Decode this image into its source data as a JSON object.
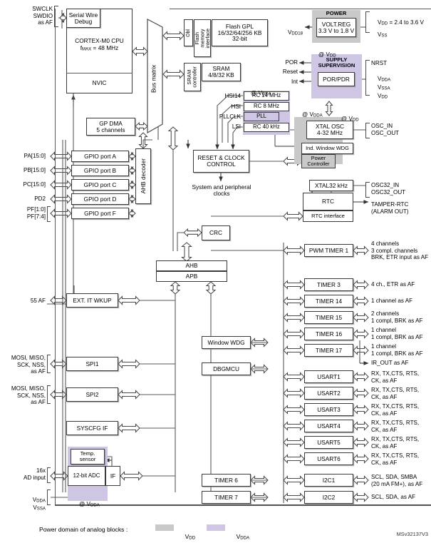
{
  "figure": {
    "id": "MSv32137V3",
    "legend_text": "Power domain of analog blocks :",
    "legend_vdd": "V",
    "legend_vdd_sub": "DD",
    "legend_vdda": "V",
    "legend_vdda_sub": "DDA",
    "color_vdd": "#c9c9c9",
    "color_vdda": "#cfc6e4"
  },
  "core": {
    "swd_pins": "SWCLK\nSWDIO\nas AF",
    "serial_wire_debug": "Serial Wire\nDebug",
    "cpu_line1": "CORTEX-M0 CPU",
    "cpu_line2_pre": "f",
    "cpu_line2_sub": "MAX",
    "cpu_line2_post": " = 48 MHz",
    "nvic": "NVIC",
    "bus_matrix": "Bus matrix",
    "ahb_decoder": "AHB decoder",
    "gp_dma": "GP DMA\n5 channels",
    "crc": "CRC",
    "ahb": "AHB",
    "apb": "APB"
  },
  "memory": {
    "obl": "Obl",
    "flash_if": "Flash\nmemory\ninterface",
    "flash": "Flash GPL\n16/32/64/256 KB\n32-bit",
    "sram_ctrl": "SRAM\ncontroller",
    "sram": "SRAM\n4/8/32 KB"
  },
  "power": {
    "title": "POWER",
    "voltreg": "VOLT.REG\n3.3 V to 1.8 V",
    "vdd18": "V",
    "vdd18_sub": "DD18",
    "at_vdd": "@ V",
    "at_vdd_sub": "DD",
    "supply_title": "SUPPLY\nSUPERVISION",
    "por_pdr": "POR/PDR",
    "por": "POR",
    "reset": "Reset",
    "int": "Int",
    "at_vdda": "@ V",
    "at_vdda_sub": "DDA",
    "vdd_range": "V",
    "vdd_range_sub": "DD",
    "vdd_range_post": " = 2.4 to 3.6 V",
    "vss": "V",
    "vss_sub": "SS",
    "nrst_pins": "NRST",
    "vdda_pin": "V",
    "vdda_pin_sub": "DDA",
    "vssa_pin": "V",
    "vssa_pin_sub": "SSA",
    "vdd_pin": "V",
    "vdd_pin_sub": "DD"
  },
  "clocks": {
    "hsi14": "HSI14",
    "hsi": "HSI",
    "pllclk": "PLLCLK",
    "lsi": "LSI",
    "rc14": "RC 14 MHz",
    "rc8": "RC 8 MHz",
    "pll": "PLL",
    "rc40": "RC 40 kHz",
    "rcc": "RESET & CLOCK\nCONTROL",
    "sys_clocks": "System and peripheral\nclocks",
    "xtal_osc": "XTAL OSC\n4-32 MHz",
    "iwdg": "Ind. Window WDG",
    "power_ctrl": "Power\nController",
    "osc_pins": "OSC_IN\nOSC_OUT",
    "xtal32": "XTAL32 kHz",
    "osc32_pins": "OSC32_IN\nOSC32_OUT"
  },
  "gpio": {
    "ports": [
      {
        "pins": "PA[15:0]",
        "label": "GPIO port A"
      },
      {
        "pins": "PB[15:0]",
        "label": "GPIO port B"
      },
      {
        "pins": "PC[15:0]",
        "label": "GPIO port C"
      },
      {
        "pins": "PD2",
        "label": "GPIO port D"
      },
      {
        "pins": "PF[1:0]\nPF[7:4]",
        "label": "GPIO port F"
      }
    ]
  },
  "rtc": {
    "rtc": "RTC",
    "rtc_if": "RTC interface",
    "tamper": "TAMPER-RTC\n(ALARM OUT)"
  },
  "timers": [
    {
      "label": "PWM TIMER 1",
      "io": "4 channels\n3 compl. channels\nBRK, ETR input as AF"
    },
    {
      "label": "TIMER 3",
      "io": "4 ch., ETR as AF"
    },
    {
      "label": "TIMER 14",
      "io": "1 channel as AF"
    },
    {
      "label": "TIMER 15",
      "io": "2 channels\n1 compl, BRK as AF"
    },
    {
      "label": "TIMER 16",
      "io": "1 channel\n1 compl, BRK as AF"
    },
    {
      "label": "TIMER 17",
      "io": "1 channel\n1 compl, BRK as AF"
    }
  ],
  "ir_out": "IR_OUT as AF",
  "usarts": [
    {
      "label": "USART1",
      "io": "RX, TX,CTS, RTS,\nCK, as AF"
    },
    {
      "label": "USART2",
      "io": "RX, TX,CTS, RTS,\nCK, as AF"
    },
    {
      "label": "USART3",
      "io": "RX, TX,CTS, RTS,\nCK, as AF"
    },
    {
      "label": "USART4",
      "io": "RX, TX,CTS, RTS,\nCK, as AF"
    },
    {
      "label": "USART5",
      "io": "RX, TX,CTS, RTS,\nCK, as AF"
    },
    {
      "label": "USART6",
      "io": "RX, TX,CTS, RTS,\nCK, as AF"
    }
  ],
  "i2c": [
    {
      "label": "I2C1",
      "io": "SCL, SDA, SMBA\n(20 mA FM+), as AF"
    },
    {
      "label": "I2C2",
      "io": "SCL, SDA, as AF"
    }
  ],
  "basic_timers": [
    {
      "label": "TIMER 6"
    },
    {
      "label": "TIMER 7"
    }
  ],
  "peripherals": {
    "ext_it": "EXT. IT  WKUP",
    "ext_it_pins": "55 AF",
    "spi1": "SPI1",
    "spi2": "SPI2",
    "spi_pins": "MOSI, MISO,\nSCK, NSS,\nas AF",
    "syscfg": "SYSCFG IF",
    "window_wdg": "Window WDG",
    "dbgmcu": "DBGMCU"
  },
  "adc": {
    "temp_sensor": "Temp.\nsensor",
    "adc": "12-bit ADC",
    "if": "IF",
    "ad_input": "16x\nAD input",
    "vdda": "V",
    "vdda_sub": "DDA",
    "vssa": "V",
    "vssa_sub": "SSA",
    "at_vdda": "@ V",
    "at_vdda_sub": "DDA"
  }
}
